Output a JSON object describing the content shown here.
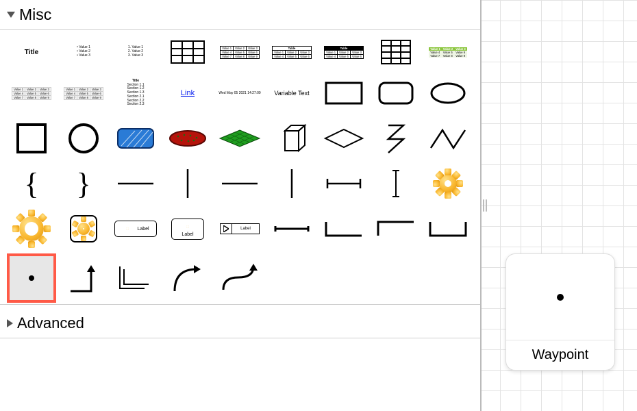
{
  "sections": {
    "misc": {
      "title": "Misc",
      "expanded": true
    },
    "advanced": {
      "title": "Advanced",
      "expanded": false
    }
  },
  "preview": {
    "label": "Waypoint"
  },
  "shapes": {
    "title_label": "Title",
    "ul_items": [
      "Value 1",
      "Value 2",
      "Value 3"
    ],
    "ol_items": [
      "Value 1",
      "Value 2",
      "Value 3"
    ],
    "link_text": "Link",
    "timestamp": "Wed May 05 2021 14:27:09",
    "variable_text": "Variable Text",
    "table_header": "Table",
    "table_cells": [
      "Value 1",
      "Value 2",
      "Value 3",
      "Value 4",
      "Value 5",
      "Value 6",
      "Value 7",
      "Value 8",
      "Value 9"
    ],
    "sections_card": {
      "title": "Title",
      "items": [
        "Section 1.1",
        "Section 1.2",
        "Section 1.3",
        "Section 2.1",
        "Section 2.2",
        "Section 2.3"
      ]
    },
    "label_text": "Label",
    "label_text2": "Label"
  }
}
